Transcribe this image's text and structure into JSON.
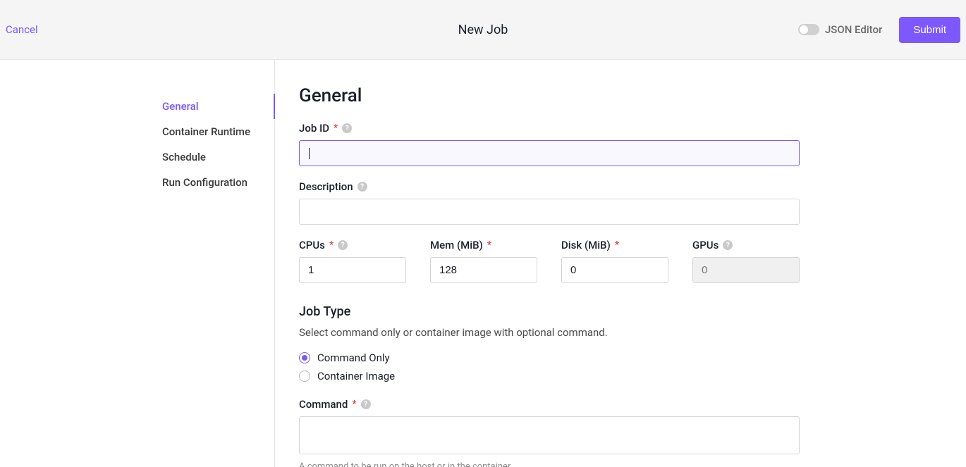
{
  "header": {
    "cancel": "Cancel",
    "title": "New Job",
    "json_toggle_label": "JSON Editor",
    "submit": "Submit"
  },
  "sidebar": {
    "items": [
      {
        "label": "General",
        "active": true
      },
      {
        "label": "Container Runtime",
        "active": false
      },
      {
        "label": "Schedule",
        "active": false
      },
      {
        "label": "Run Configuration",
        "active": false
      }
    ]
  },
  "main": {
    "section_title": "General",
    "fields": {
      "job_id": {
        "label": "Job ID",
        "value": "",
        "required": true
      },
      "description": {
        "label": "Description",
        "value": "",
        "required": false
      },
      "cpus": {
        "label": "CPUs",
        "value": "1",
        "required": true
      },
      "mem": {
        "label": "Mem (MiB)",
        "value": "128",
        "required": true
      },
      "disk": {
        "label": "Disk (MiB)",
        "value": "0",
        "required": true
      },
      "gpus": {
        "label": "GPUs",
        "placeholder": "0",
        "value": "",
        "required": false,
        "disabled": true
      }
    },
    "job_type": {
      "title": "Job Type",
      "helper": "Select command only or container image with optional command.",
      "options": [
        {
          "label": "Command Only",
          "checked": true
        },
        {
          "label": "Container Image",
          "checked": false
        }
      ]
    },
    "command": {
      "label": "Command",
      "value": "",
      "required": true,
      "hint": "A command to be run on the host or in the container."
    }
  }
}
